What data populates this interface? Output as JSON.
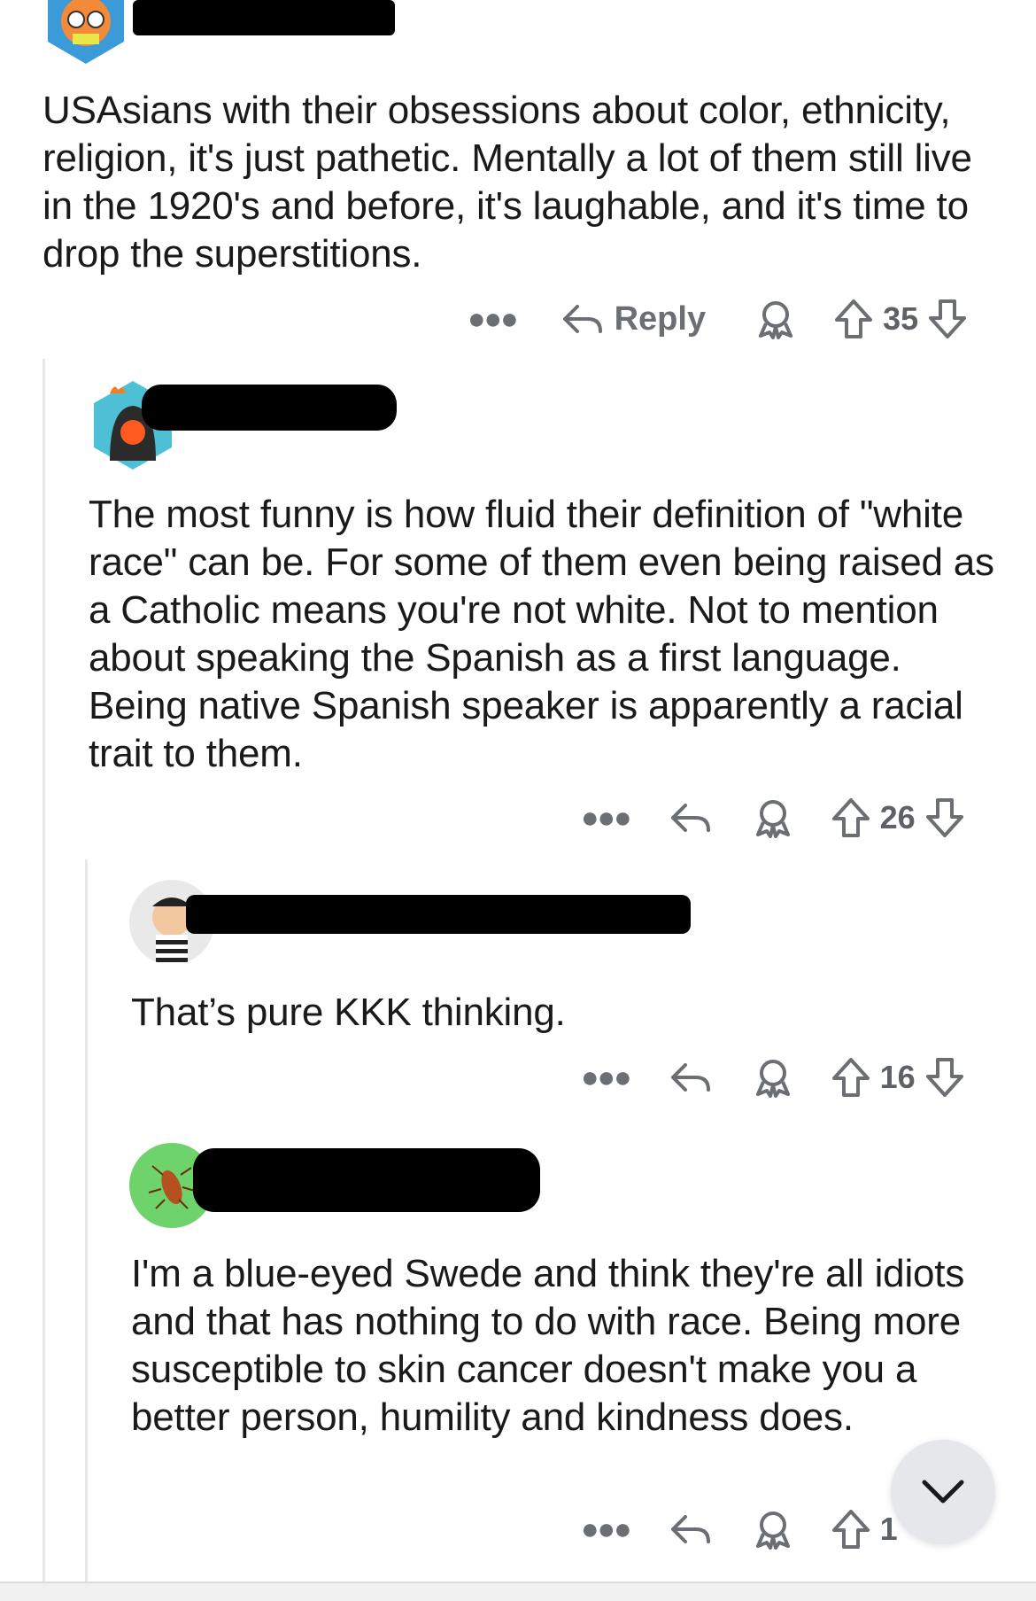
{
  "comments": [
    {
      "text": "USAsians with their obsessions about color, ethnicity, religion, it's just pathetic. Mentally a lot of them still live in the 1920's and before, it's laughable, and it's time to drop the superstitions.",
      "reply_label": "Reply",
      "votes": "35",
      "avatar_icon": "cartoon-avatar-icon"
    },
    {
      "text": "The most funny is how fluid their definition of \"white race\" can be. For some of them even being raised as a Catholic means you're not white. Not to mention about speaking the Spanish as a first language. Being native Spanish speaker is apparently a racial trait to them.",
      "votes": "26",
      "avatar_icon": "flame-hood-avatar-icon"
    },
    {
      "text": "That’s pure KKK thinking.",
      "votes": "16",
      "avatar_icon": "striped-shirt-avatar-icon"
    },
    {
      "text": "I'm a blue-eyed Swede and think they're all idiots and that has nothing to do with race. Being more susceptible to skin cancer doesn't make you a better person, humility and kindness does.",
      "votes": "1",
      "avatar_icon": "cockroach-avatar-icon"
    }
  ],
  "colors": {
    "action_gray": "#6b6e72",
    "thread_line": "#e6e8ea",
    "avatar_green": "#6fd36b",
    "fab_bg": "#e5e7ea"
  }
}
